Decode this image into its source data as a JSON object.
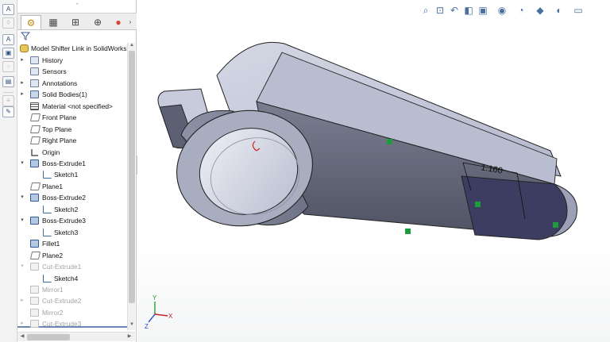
{
  "feature_manager": {
    "items": [
      {
        "label": "Model Shifter Link in SolidWorks  (D",
        "icon": "part-icon"
      },
      {
        "label": "History",
        "icon": "history-icon"
      },
      {
        "label": "Sensors",
        "icon": "sensors-icon"
      },
      {
        "label": "Annotations",
        "icon": "annotations-icon"
      },
      {
        "label": "Solid Bodies(1)",
        "icon": "solid-bodies-icon"
      },
      {
        "label": "Material <not specified>",
        "icon": "material-icon"
      },
      {
        "label": "Front Plane",
        "icon": "plane-icon"
      },
      {
        "label": "Top Plane",
        "icon": "plane-icon"
      },
      {
        "label": "Right Plane",
        "icon": "plane-icon"
      },
      {
        "label": "Origin",
        "icon": "origin-icon"
      },
      {
        "label": "Boss-Extrude1",
        "icon": "boss-extrude-icon"
      },
      {
        "label": "Sketch1",
        "icon": "sketch-icon"
      },
      {
        "label": "Plane1",
        "icon": "plane-icon"
      },
      {
        "label": "Boss-Extrude2",
        "icon": "boss-extrude-icon"
      },
      {
        "label": "Sketch2",
        "icon": "sketch-icon"
      },
      {
        "label": "Boss-Extrude3",
        "icon": "boss-extrude-icon"
      },
      {
        "label": "Sketch3",
        "icon": "sketch-icon"
      },
      {
        "label": "Fillet1",
        "icon": "fillet-icon"
      },
      {
        "label": "Plane2",
        "icon": "plane-icon"
      },
      {
        "label": "Cut-Extrude1",
        "icon": "cut-extrude-icon"
      },
      {
        "label": "Sketch4",
        "icon": "sketch-icon"
      },
      {
        "label": "Mirror1",
        "icon": "mirror-icon"
      },
      {
        "label": "Cut-Extrude2",
        "icon": "cut-extrude-icon"
      },
      {
        "label": "Mirror2",
        "icon": "mirror-icon"
      },
      {
        "label": "Cut-Extrude3",
        "icon": "cut-extrude-icon"
      }
    ]
  },
  "viewport": {
    "dimension_value": "1.160",
    "triad": {
      "x": "X",
      "y": "Y",
      "z": "Z"
    }
  },
  "colors": {
    "model_top": "#c3c7d8",
    "model_side": "#6c6f80",
    "model_face": "#a1a5bb",
    "selected_face": "#3c3e61",
    "dimension": "#111111",
    "selection_handle": "#1e9b3c"
  }
}
